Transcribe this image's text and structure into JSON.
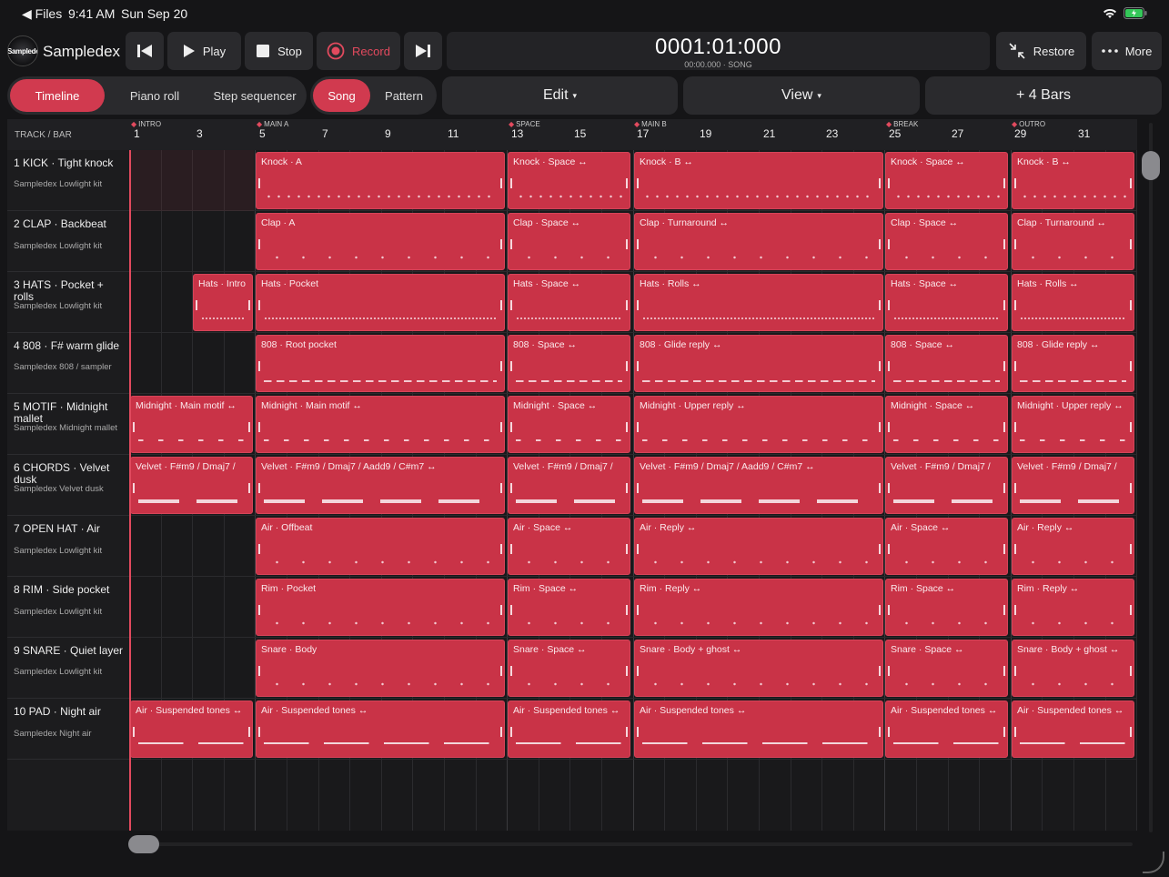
{
  "status": {
    "back": "◀ Files",
    "time": "9:41 AM",
    "date": "Sun Sep 20"
  },
  "app": {
    "logo_text": "Sampledex",
    "name": "Sampledex"
  },
  "transport": {
    "play": "Play",
    "stop": "Stop",
    "record": "Record",
    "restore": "Restore",
    "more": "More"
  },
  "time": {
    "main": "0001:01:000",
    "sub": "00:00.000 · SONG"
  },
  "modes": {
    "timeline": "Timeline",
    "piano_roll": "Piano roll",
    "step_sequencer": "Step sequencer",
    "song": "Song",
    "pattern": "Pattern",
    "edit": "Edit",
    "view": "View",
    "add_bars": "+ 4 Bars"
  },
  "grid": {
    "header": "TRACK / BAR",
    "bars": [
      "1",
      "3",
      "5",
      "7",
      "9",
      "11",
      "13",
      "15",
      "17",
      "19",
      "21",
      "23",
      "25",
      "27",
      "29",
      "31"
    ],
    "markers": [
      "INTRO",
      "MAIN A",
      "SPACE",
      "MAIN B",
      "BREAK",
      "OUTRO"
    ]
  },
  "tracks": [
    {
      "title": "1  KICK · Tight knock",
      "kit": "Sampledex Lowlight kit"
    },
    {
      "title": "2  CLAP · Backbeat",
      "kit": "Sampledex Lowlight kit"
    },
    {
      "title": "3  HATS · Pocket + rolls",
      "kit": "Sampledex Lowlight kit"
    },
    {
      "title": "4  808 · F# warm glide",
      "kit": "Sampledex 808 / sampler"
    },
    {
      "title": "5  MOTIF · Midnight mallet",
      "kit": "Sampledex Midnight mallet"
    },
    {
      "title": "6  CHORDS · Velvet dusk",
      "kit": "Sampledex Velvet dusk"
    },
    {
      "title": "7  OPEN HAT · Air",
      "kit": "Sampledex Lowlight kit"
    },
    {
      "title": "8  RIM · Side pocket",
      "kit": "Sampledex Lowlight kit"
    },
    {
      "title": "9  SNARE · Quiet layer",
      "kit": "Sampledex Lowlight kit"
    },
    {
      "title": "10  PAD · Night air",
      "kit": "Sampledex Night air"
    }
  ],
  "clips": [
    [
      "",
      "Knock · A",
      "Knock · Space ↔",
      "Knock · B ↔",
      "Knock · Space ↔",
      "Knock · B ↔"
    ],
    [
      "",
      "Clap · A",
      "Clap · Space ↔",
      "Clap · Turnaround ↔",
      "Clap · Space ↔",
      "Clap · Turnaround ↔"
    ],
    [
      "Hats · Intro",
      "Hats · Pocket",
      "Hats · Space ↔",
      "Hats · Rolls ↔",
      "Hats · Space ↔",
      "Hats · Rolls ↔"
    ],
    [
      "",
      "808 · Root pocket",
      "808 · Space ↔",
      "808 · Glide reply ↔",
      "808 · Space ↔",
      "808 · Glide reply ↔"
    ],
    [
      "Midnight · Main motif ↔",
      "Midnight · Main motif ↔",
      "Midnight · Space ↔",
      "Midnight · Upper reply ↔",
      "Midnight · Space ↔",
      "Midnight · Upper reply ↔"
    ],
    [
      "Velvet · F#m9 / Dmaj7 /",
      "Velvet · F#m9 / Dmaj7 / Aadd9 / C#m7 ↔",
      "Velvet · F#m9 / Dmaj7 /",
      "Velvet · F#m9 / Dmaj7 / Aadd9 / C#m7 ↔",
      "Velvet · F#m9 / Dmaj7 /",
      "Velvet · F#m9 / Dmaj7 /"
    ],
    [
      "",
      "Air · Offbeat",
      "Air · Space ↔",
      "Air · Reply ↔",
      "Air · Space ↔",
      "Air · Reply ↔"
    ],
    [
      "",
      "Rim · Pocket",
      "Rim · Space ↔",
      "Rim · Reply ↔",
      "Rim · Space ↔",
      "Rim · Reply ↔"
    ],
    [
      "",
      "Snare · Body",
      "Snare · Space ↔",
      "Snare · Body + ghost ↔",
      "Snare · Space ↔",
      "Snare · Body + ghost ↔"
    ],
    [
      "Air · Suspended tones ↔",
      "Air · Suspended tones ↔",
      "Air · Suspended tones ↔",
      "Air · Suspended tones ↔",
      "Air · Suspended tones ↔",
      "Air · Suspended tones ↔"
    ]
  ]
}
